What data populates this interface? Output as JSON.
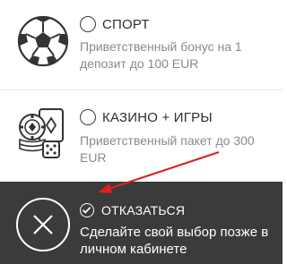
{
  "options": {
    "sport": {
      "title": "СПОРТ",
      "description": "Приветственный бонус на 1 депозит до 100 EUR",
      "icon": "soccer-ball-icon"
    },
    "casino": {
      "title": "КАЗИНО + ИГРЫ",
      "description": "Приветственный пакет до 300 EUR",
      "icon": "casino-chips-cards-dice-icon"
    }
  },
  "decline": {
    "title": "ОТКАЗАТЬСЯ",
    "description": "Сделайте свой выбор позже в личном кабинете",
    "selected": true,
    "icon": "close-circle-icon"
  },
  "colors": {
    "panel_bg": "#ffffff",
    "decline_bg": "#3b3b3b",
    "arrow": "#e02020",
    "text_dark": "#2f2f2f",
    "text_muted": "#8a8a8a"
  }
}
